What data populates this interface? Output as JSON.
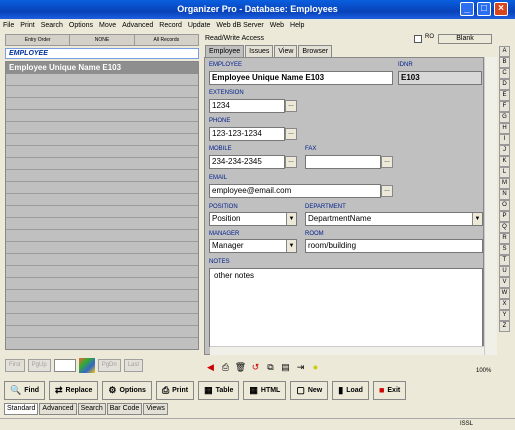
{
  "window": {
    "title": "Organizer Pro - Database: Employees",
    "min": "_",
    "max": "□",
    "close": "×"
  },
  "menu": [
    "File",
    "Print",
    "Search",
    "Options",
    "Move",
    "Advanced",
    "Record",
    "Update",
    "Web dB Server",
    "Web",
    "Help"
  ],
  "left_toolbar": {
    "entry_order": "Entry Order",
    "none": "NONE",
    "all_records": "All Records"
  },
  "list": {
    "header": "EMPLOYEE",
    "rows": [
      "Employee Unique Name E103"
    ]
  },
  "nav": {
    "first": "First",
    "pgup": "PgUp",
    "pgdn": "PgDn",
    "last": "Last"
  },
  "access": "Read/Write Access",
  "ro": "RO",
  "blank": "Blank",
  "tabs": [
    "Employee",
    "Issues",
    "View",
    "Browser"
  ],
  "form": {
    "employee_label": "EMPLOYEE",
    "employee_value": "Employee Unique Name E103",
    "idnr_label": "IDNR",
    "idnr_value": "E103",
    "extension_label": "EXTENSION",
    "extension_value": "1234",
    "phone_label": "PHONE",
    "phone_value": "123-123-1234",
    "mobile_label": "MOBILE",
    "mobile_value": "234-234-2345",
    "fax_label": "FAX",
    "fax_value": "",
    "email_label": "EMAIL",
    "email_value": "employee@email.com",
    "position_label": "POSITION",
    "position_value": "Position",
    "department_label": "DEPARTMENT",
    "department_value": "DepartmentName",
    "manager_label": "MANAGER",
    "manager_value": "Manager",
    "room_label": "ROOM",
    "room_value": "room/building",
    "notes_label": "NOTES",
    "notes_value": "other notes"
  },
  "alphabet": [
    "A",
    "B",
    "C",
    "D",
    "E",
    "F",
    "G",
    "H",
    "I",
    "J",
    "K",
    "L",
    "M",
    "N",
    "O",
    "P",
    "Q",
    "R",
    "S",
    "T",
    "U",
    "V",
    "W",
    "X",
    "Y",
    "Z"
  ],
  "zoom": "100%",
  "buttons": [
    "Find",
    "Replace",
    "Options",
    "Print",
    "Table",
    "HTML",
    "New",
    "Load",
    "Exit"
  ],
  "bottom_tabs": [
    "Standard",
    "Advanced",
    "Search",
    "Bar Code",
    "Views"
  ],
  "status": "ISSL"
}
